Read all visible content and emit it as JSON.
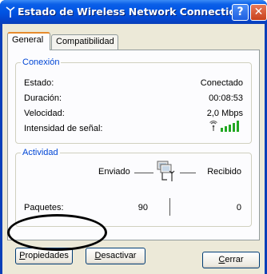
{
  "window": {
    "title": "Estado de Wireless Network Connection",
    "help_glyph": "?",
    "close_glyph": "✕"
  },
  "tabs": [
    {
      "label": "General",
      "active": true
    },
    {
      "label": "Compatibilidad",
      "active": false
    }
  ],
  "conexion": {
    "group_label": "Conexión",
    "rows": [
      {
        "label": "Estado:",
        "value": "Conectado"
      },
      {
        "label": "Duración:",
        "value": "00:08:53"
      },
      {
        "label": "Velocidad:",
        "value": "2,0 Mbps"
      },
      {
        "label": "Intensidad de señal:",
        "value": ""
      }
    ],
    "signal_bars_lit": 5,
    "signal_bars_total": 5
  },
  "actividad": {
    "group_label": "Actividad",
    "sent_label": "Enviado",
    "received_label": "Recibido",
    "packets_label": "Paquetes:",
    "packets_sent": "90",
    "packets_received": "0"
  },
  "buttons": {
    "properties": {
      "accel": "P",
      "rest": "ropiedades"
    },
    "disable": {
      "accel": "D",
      "rest": "esactivar"
    },
    "close": {
      "accel": "C",
      "rest": "errar"
    }
  },
  "colors": {
    "accent_blue": "#0046d5",
    "signal_green": "#22a822",
    "titlebar_blue": "#0054e3"
  }
}
